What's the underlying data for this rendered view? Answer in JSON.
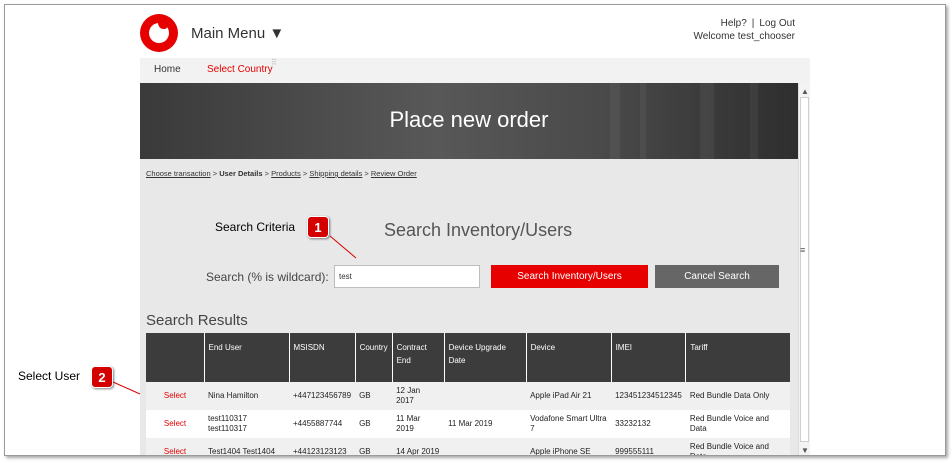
{
  "header": {
    "main_menu": "Main Menu ▼",
    "help": "Help?",
    "separator": "|",
    "logout": "Log Out",
    "welcome": "Welcome test_chooser"
  },
  "nav": {
    "home": "Home",
    "select_country": "Select Country"
  },
  "banner": {
    "title": "Place new order"
  },
  "breadcrumb": {
    "steps": [
      "Choose transaction",
      "User Details",
      "Products",
      "Shipping details",
      "Review Order"
    ],
    "separator": ">"
  },
  "search": {
    "heading": "Search Inventory/Users",
    "label": "Search (% is wildcard):",
    "value": "test",
    "search_button": "Search Inventory/Users",
    "cancel_button": "Cancel Search"
  },
  "results": {
    "title": "Search Results",
    "columns": [
      "",
      "End User",
      "MSISDN",
      "Country",
      "Contract End",
      "Device Upgrade Date",
      "Device",
      "IMEI",
      "Tariff"
    ],
    "rows": [
      {
        "select": "Select",
        "end_user": "Nina Hamilton",
        "msisdn": "+447123456789",
        "country": "GB",
        "contract_end": "12 Jan 2017",
        "upgrade": "",
        "device": "Apple iPad Air 21",
        "imei": "123451234512345",
        "tariff": "Red Bundle Data Only"
      },
      {
        "select": "Select",
        "end_user": "test110317 test110317",
        "msisdn": "+4455887744",
        "country": "GB",
        "contract_end": "11 Mar 2019",
        "upgrade": "11 Mar 2019",
        "device": "Vodafone Smart Ultra 7",
        "imei": "33232132",
        "tariff": "Red Bundle Voice and Data"
      },
      {
        "select": "Select",
        "end_user": "Test1404 Test1404",
        "msisdn": "+44123123123",
        "country": "GB",
        "contract_end": "14 Apr 2019",
        "upgrade": "",
        "device": "Apple iPhone SE",
        "imei": "999555111",
        "tariff": "Red Bundle Voice and Data"
      }
    ]
  },
  "callouts": [
    {
      "label": "Search Criteria",
      "number": "1"
    },
    {
      "label": "Select User",
      "number": "2"
    }
  ],
  "colors": {
    "brand_red": "#e60000",
    "dark_header": "#3c3c3c",
    "button_grey": "#666666"
  }
}
